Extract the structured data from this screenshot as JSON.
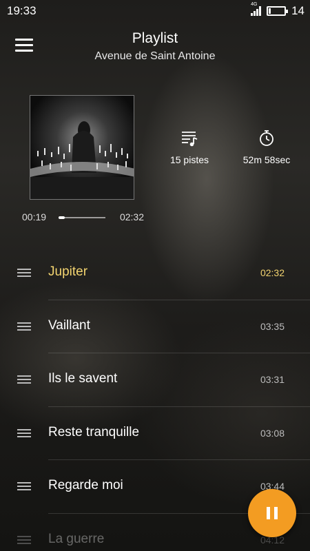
{
  "status_bar": {
    "time": "19:33",
    "network": "4G",
    "battery_level": "14",
    "battery_fraction": 0.14
  },
  "header": {
    "title": "Playlist",
    "subtitle": "Avenue de Saint Antoine"
  },
  "stats": {
    "tracks": "15 pistes",
    "duration": "52m 58sec"
  },
  "player": {
    "current_time": "00:19",
    "total_time": "02:32",
    "progress_fraction": 0.13
  },
  "tracks": [
    {
      "name": "Jupiter",
      "duration": "02:32",
      "active": true
    },
    {
      "name": "Vaillant",
      "duration": "03:35"
    },
    {
      "name": "Ils le savent",
      "duration": "03:31"
    },
    {
      "name": "Reste tranquille",
      "duration": "03:08"
    },
    {
      "name": "Regarde moi",
      "duration": "03:44"
    },
    {
      "name": "La guerre",
      "duration": "04:12"
    }
  ],
  "colors": {
    "accent": "#f39c22",
    "active_track": "#f3d470"
  }
}
